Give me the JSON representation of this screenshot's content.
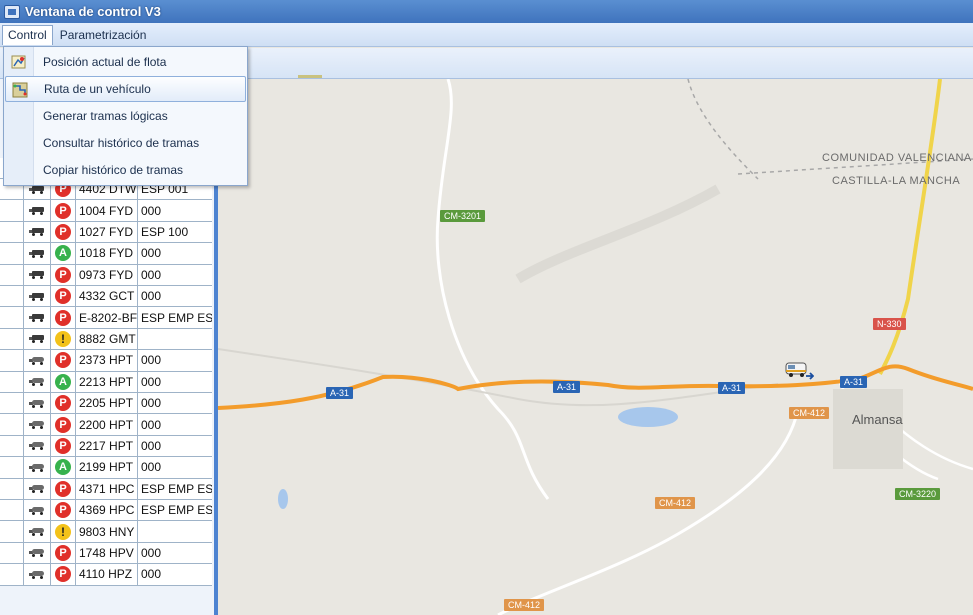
{
  "window": {
    "title": "Ventana de control V3"
  },
  "menubar": {
    "items": [
      "Control",
      "Parametrización"
    ]
  },
  "control_menu": {
    "items": [
      {
        "label": "Posición actual de flota",
        "icon": "fleet-map-icon",
        "highlighted": false
      },
      {
        "label": "Ruta de un vehículo",
        "icon": "route-icon",
        "highlighted": true
      },
      {
        "label": "Generar tramas lógicas",
        "icon": "",
        "highlighted": false
      },
      {
        "label": "Consultar histórico de tramas",
        "icon": "",
        "highlighted": false
      },
      {
        "label": "Copiar histórico de tramas",
        "icon": "",
        "highlighted": false
      }
    ]
  },
  "vehicles": [
    {
      "type": "truck",
      "status": "P",
      "plate": "4402 DTW",
      "code": "ESP 001"
    },
    {
      "type": "truck",
      "status": "P",
      "plate": "1004 FYD",
      "code": "000"
    },
    {
      "type": "truck",
      "status": "P",
      "plate": "1027 FYD",
      "code": "ESP 100"
    },
    {
      "type": "truck",
      "status": "A",
      "plate": "1018 FYD",
      "code": "000"
    },
    {
      "type": "truck",
      "status": "P",
      "plate": "0973 FYD",
      "code": "000"
    },
    {
      "type": "truck",
      "status": "P",
      "plate": "4332 GCT",
      "code": "000"
    },
    {
      "type": "truck",
      "status": "P",
      "plate": "E-8202-BF",
      "code": "ESP EMP ESP"
    },
    {
      "type": "truck",
      "status": "!",
      "plate": "8882 GMT",
      "code": ""
    },
    {
      "type": "car",
      "status": "P",
      "plate": "2373 HPT",
      "code": "000"
    },
    {
      "type": "car",
      "status": "A",
      "plate": "2213 HPT",
      "code": "000"
    },
    {
      "type": "car",
      "status": "P",
      "plate": "2205 HPT",
      "code": "000"
    },
    {
      "type": "car",
      "status": "P",
      "plate": "2200 HPT",
      "code": "000"
    },
    {
      "type": "car",
      "status": "P",
      "plate": "2217 HPT",
      "code": "000"
    },
    {
      "type": "car",
      "status": "A",
      "plate": "2199 HPT",
      "code": "000"
    },
    {
      "type": "car",
      "status": "P",
      "plate": "4371 HPC",
      "code": "ESP EMP ESP"
    },
    {
      "type": "car",
      "status": "P",
      "plate": "4369 HPC",
      "code": "ESP EMP ESP"
    },
    {
      "type": "car",
      "status": "!",
      "plate": "9803 HNY",
      "code": ""
    },
    {
      "type": "car",
      "status": "P",
      "plate": "1748 HPV",
      "code": "000"
    },
    {
      "type": "car",
      "status": "P",
      "plate": "4110 HPZ",
      "code": "000"
    }
  ],
  "map": {
    "region_labels": [
      "COMUNIDAD VALENCIANA",
      "CASTILLA-LA MANCHA"
    ],
    "city": "Almansa",
    "road_shields": [
      {
        "text": "CM-3201",
        "color": "green"
      },
      {
        "text": "N-330",
        "color": "red"
      },
      {
        "text": "A-31",
        "color": "blue"
      },
      {
        "text": "A-31",
        "color": "blue"
      },
      {
        "text": "A-31",
        "color": "blue"
      },
      {
        "text": "A-31",
        "color": "blue"
      },
      {
        "text": "CM-412",
        "color": "orange"
      },
      {
        "text": "CM-412",
        "color": "orange"
      },
      {
        "text": "CM-412",
        "color": "orange"
      },
      {
        "text": "CM-3220",
        "color": "green"
      }
    ]
  }
}
